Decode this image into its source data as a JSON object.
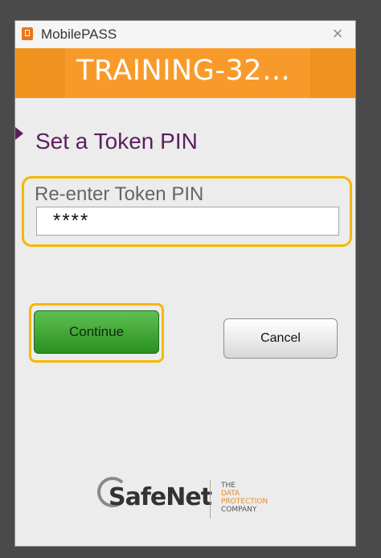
{
  "window": {
    "app_title": "MobilePASS",
    "close_glyph": "×",
    "banner_title": "TRAINING-32…"
  },
  "main": {
    "heading": "Set a Token PIN",
    "pin_label": "Re-enter Token PIN",
    "pin_value": "****"
  },
  "buttons": {
    "continue": "Continue",
    "cancel": "Cancel"
  },
  "logo": {
    "brand": "SafeNet",
    "tagline": [
      "THE",
      "DATA",
      "PROTECTION",
      "COMPANY"
    ]
  },
  "colors": {
    "banner": "#f0921e",
    "heading": "#5c1f5e",
    "focus_outline": "#f5b800",
    "continue_button": "#3aa52c"
  }
}
